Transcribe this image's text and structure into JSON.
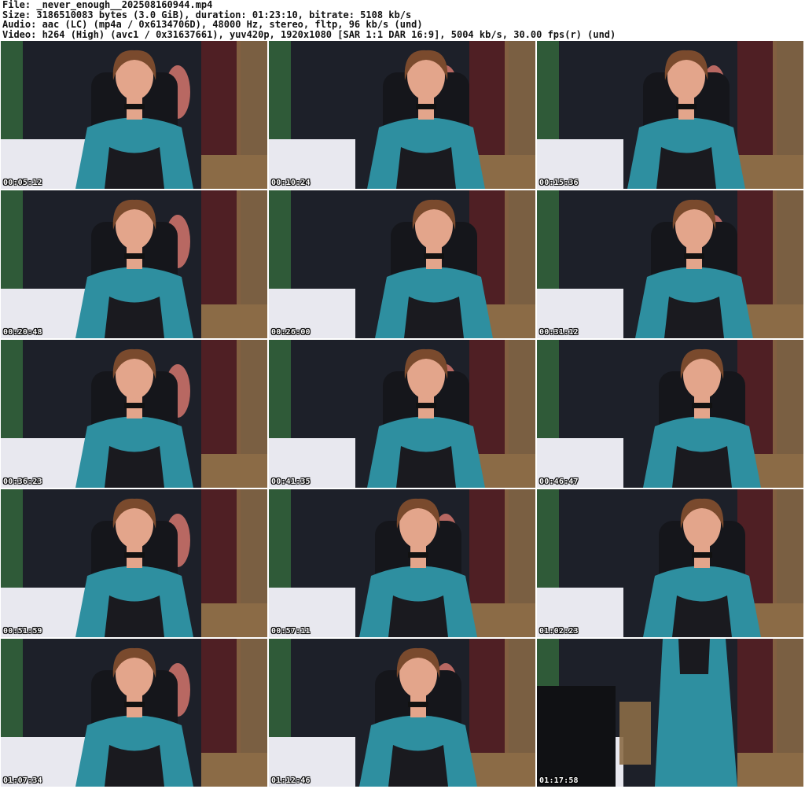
{
  "header": {
    "file_line": "File: _never_enough__202508160944.mp4",
    "size_line": "Size: 3186510083 bytes (3.0 GiB), duration: 01:23:10, bitrate: 5108 kb/s",
    "audio_line": "Audio: aac (LC) (mp4a / 0x6134706D), 48000 Hz, stereo, fltp, 96 kb/s (und)",
    "video_line": "Video: h264 (High) (avc1 / 0x31637661), yuv420p, 1920x1080 [SAR 1:1 DAR 16:9], 5004 kb/s, 30.00 fps(r) (und)"
  },
  "colors": {
    "background": "#ffffff",
    "header_text": "#111111",
    "timestamp_text": "#ffffff",
    "scene_dark": "#1d2029",
    "scene_wall_left": "#2f5a38",
    "scene_wall_right": "#4f1f24",
    "scene_lamp": "#e07a71",
    "scene_wood": "#8b6b46",
    "scene_bed": "#e8e8ef",
    "outfit": "#2e8fa0",
    "outfit_dark": "#1b5e6e",
    "skin": "#e3a58b",
    "hair": "#7a4a2d"
  },
  "thumbnails": [
    {
      "time": "00:05:12"
    },
    {
      "time": "00:10:24"
    },
    {
      "time": "00:15:36"
    },
    {
      "time": "00:20:48"
    },
    {
      "time": "00:26:00"
    },
    {
      "time": "00:31:12"
    },
    {
      "time": "00:36:23"
    },
    {
      "time": "00:41:35"
    },
    {
      "time": "00:46:47"
    },
    {
      "time": "00:51:59"
    },
    {
      "time": "00:57:11"
    },
    {
      "time": "01:02:23"
    },
    {
      "time": "01:07:34"
    },
    {
      "time": "01:12:46"
    },
    {
      "time": "01:17:58"
    }
  ]
}
